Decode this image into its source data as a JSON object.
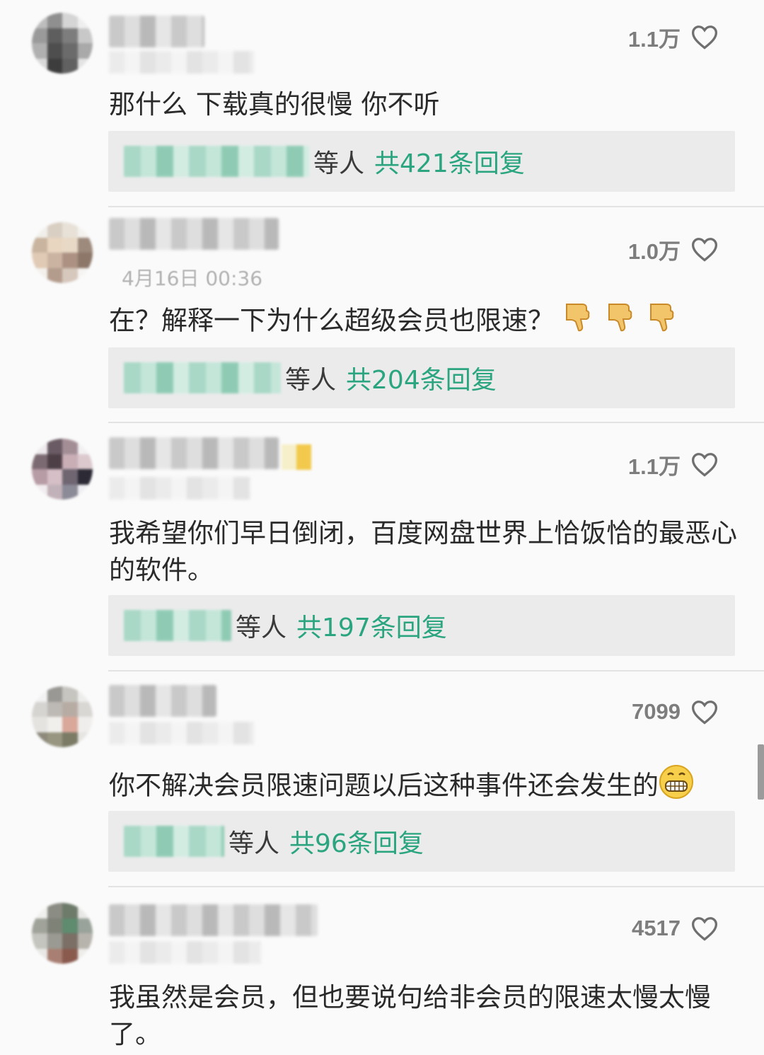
{
  "colors": {
    "background": "#fafafa",
    "reply_box": "#ebebeb",
    "reply_link": "#2aa57f",
    "like_count": "#7d7d7d",
    "divider": "#e3e3e3"
  },
  "comments": [
    {
      "date": "",
      "likes": "1.1万",
      "text": "那什么 下载真的很慢 你不听",
      "reply_by": "等人",
      "reply_total": "共421条回复"
    },
    {
      "date": "4月16日 00:36",
      "likes": "1.0万",
      "text": "在？解释一下为什么超级会员也限速？",
      "emoji": [
        "thumbs-down-icon",
        "thumbs-down-icon",
        "thumbs-down-icon"
      ],
      "reply_by": "等人",
      "reply_total": "共204条回复"
    },
    {
      "date": "",
      "likes": "1.1万",
      "text": "我希望你们早日倒闭，百度网盘世界上恰饭恰的最恶心的软件。",
      "reply_by": "等人",
      "reply_total": "共197条回复"
    },
    {
      "date": "",
      "likes": "7099",
      "text": "你不解决会员限速问题以后这种事件还会发生的",
      "emoji": [
        "grinning-face-icon"
      ],
      "reply_by": "等人",
      "reply_total": "共96条回复"
    },
    {
      "date": "",
      "likes": "4517",
      "text": "我虽然是会员，但也要说句给非会员的限速太慢太慢了。"
    }
  ]
}
